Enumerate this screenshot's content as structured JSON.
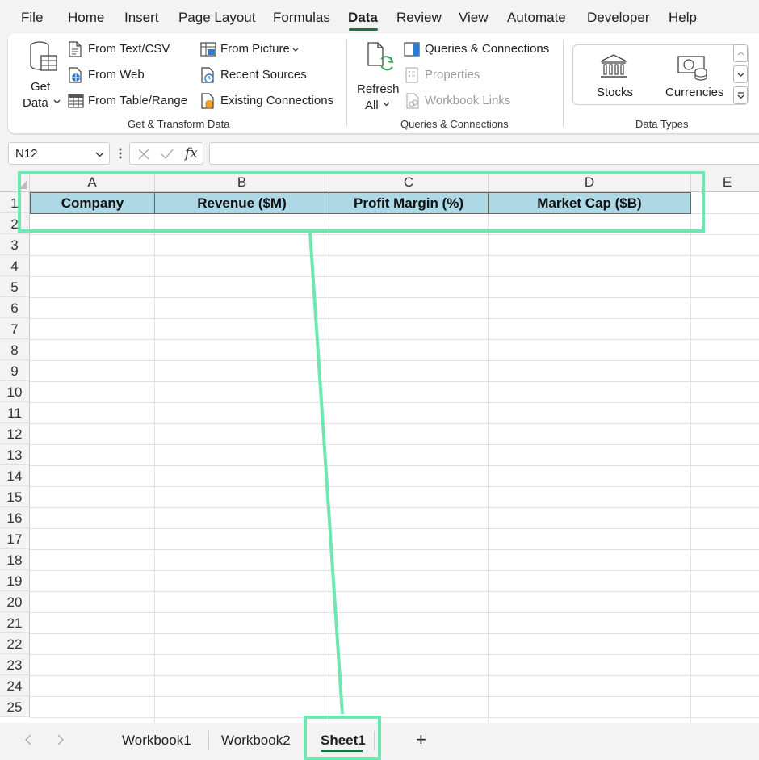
{
  "menu": {
    "items": [
      "File",
      "Home",
      "Insert",
      "Page Layout",
      "Formulas",
      "Data",
      "Review",
      "View",
      "Automate",
      "Developer",
      "Help"
    ],
    "active": "Data"
  },
  "ribbon": {
    "get_transform": {
      "get_data_line1": "Get",
      "get_data_line2": "Data",
      "from_text_csv": "From Text/CSV",
      "from_web": "From Web",
      "from_table_range": "From Table/Range",
      "from_picture": "From Picture",
      "recent_sources": "Recent Sources",
      "existing_connections": "Existing Connections",
      "group_label": "Get & Transform Data"
    },
    "queries": {
      "refresh_line1": "Refresh",
      "refresh_line2": "All",
      "queries_connections": "Queries & Connections",
      "properties": "Properties",
      "workbook_links": "Workbook Links",
      "group_label": "Queries & Connections"
    },
    "data_types": {
      "stocks": "Stocks",
      "currencies": "Currencies",
      "group_label": "Data Types"
    }
  },
  "formula_bar": {
    "name_box": "N12",
    "fx_label": "fx",
    "formula": ""
  },
  "grid": {
    "columns": [
      "A",
      "B",
      "C",
      "D",
      "E"
    ],
    "rows": [
      "1",
      "2",
      "3",
      "4",
      "5",
      "6",
      "7",
      "8",
      "9",
      "10",
      "11",
      "12",
      "13",
      "14",
      "15",
      "16",
      "17",
      "18",
      "19",
      "20",
      "21",
      "22",
      "23",
      "24",
      "25"
    ],
    "header_cells": [
      "Company",
      "Revenue ($M)",
      "Profit Margin (%)",
      "Market Cap ($B)"
    ],
    "header_fill": "#add8e6"
  },
  "sheet_tabs": {
    "tabs": [
      "Workbook1",
      "Workbook2",
      "Sheet1"
    ],
    "active": "Sheet1",
    "add_label": "+"
  },
  "annotation": {
    "color": "#6ee7b0"
  }
}
